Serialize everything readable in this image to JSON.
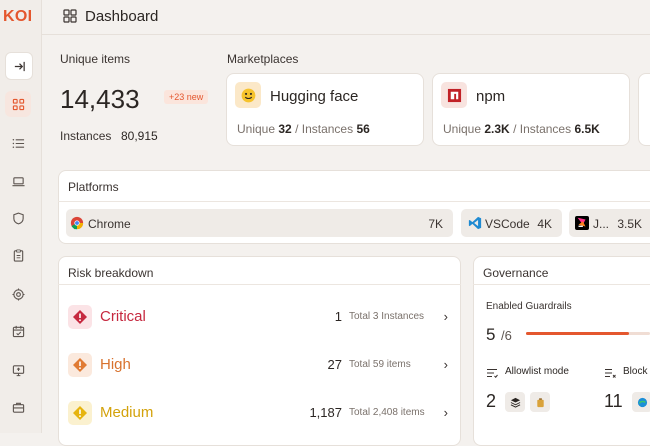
{
  "app": {
    "logo": "KOI",
    "page_title": "Dashboard"
  },
  "summary": {
    "unique_label": "Unique items",
    "unique_value": "14,433",
    "new_badge": "+23 new",
    "instances_label": "Instances",
    "instances_value": "80,915"
  },
  "marketplaces": {
    "label": "Marketplaces",
    "items": [
      {
        "name": "Hugging face",
        "unique_label": "Unique",
        "unique": "32",
        "instances_label": "/ Instances",
        "instances": "56",
        "icon": "hugging-face-icon"
      },
      {
        "name": "npm",
        "unique_label": "Unique",
        "unique": "2.3K",
        "instances_label": "/ Instances",
        "instances": "6.5K",
        "icon": "npm-icon"
      }
    ]
  },
  "platforms": {
    "label": "Platforms",
    "items": [
      {
        "name": "Chrome",
        "count": "7K",
        "icon": "chrome-icon"
      },
      {
        "name": "VSCode",
        "count": "4K",
        "icon": "vscode-icon"
      },
      {
        "name": "J...",
        "count": "3.5K",
        "icon": "jetbrains-icon"
      }
    ]
  },
  "risk": {
    "label": "Risk breakdown",
    "rows": [
      {
        "name": "Critical",
        "count": "1",
        "total": "Total 3 Instances",
        "color": "#c6283f",
        "bg": "#fbe3e6"
      },
      {
        "name": "High",
        "count": "27",
        "total": "Total 59 items",
        "color": "#d8722e",
        "bg": "#fbe9dd"
      },
      {
        "name": "Medium",
        "count": "1,187",
        "total": "Total 2,408 items",
        "color": "#d3a20b",
        "bg": "#fbf1cf"
      }
    ]
  },
  "governance": {
    "label": "Governance",
    "guardrails_label": "Enabled Guardrails",
    "guardrails_value": "5",
    "guardrails_total": "/6",
    "guardrails_fraction": 0.83,
    "allowlist_label": "Allowlist mode",
    "allowlist_value": "2",
    "block_label": "Block",
    "block_value": "11"
  },
  "colors": {
    "accent": "#e4572e"
  }
}
